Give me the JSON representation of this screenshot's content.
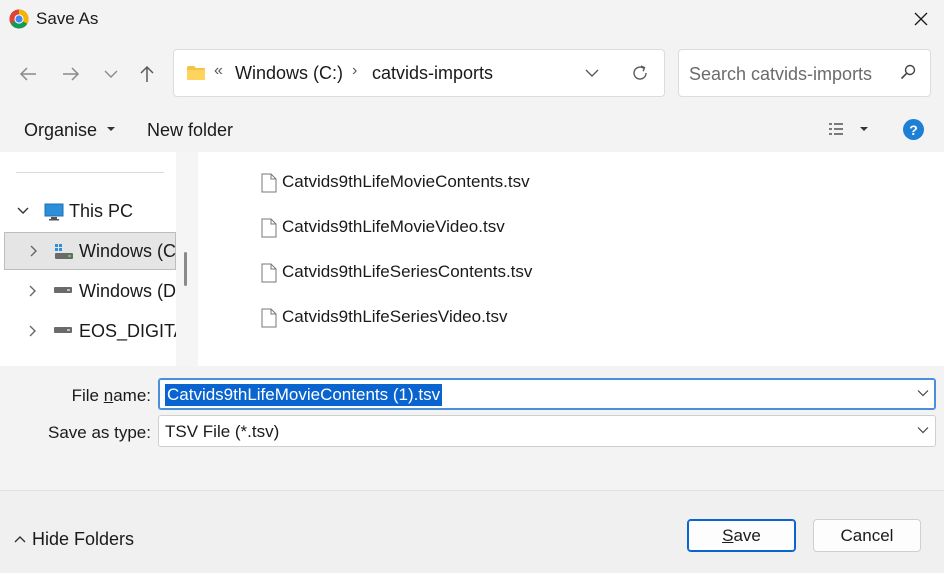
{
  "window": {
    "title": "Save As"
  },
  "address": {
    "overflow_glyph": "«",
    "segments": [
      "Windows (C:)",
      "catvids-imports"
    ],
    "separator": "›"
  },
  "search": {
    "placeholder": "Search catvids-imports"
  },
  "toolbar": {
    "organise_label": "Organise",
    "new_folder_label": "New folder",
    "help_label": "?"
  },
  "nav_tree": {
    "items": [
      {
        "label": "This PC",
        "expanded": true
      },
      {
        "label": "Windows (C",
        "selected": true
      },
      {
        "label": "Windows (D"
      },
      {
        "label": "EOS_DIGITA"
      }
    ]
  },
  "files": [
    "Catvids9thLifeMovieContents.tsv",
    "Catvids9thLifeMovieVideo.tsv",
    "Catvids9thLifeSeriesContents.tsv",
    "Catvids9thLifeSeriesVideo.tsv"
  ],
  "form": {
    "file_name_label_pre": "File ",
    "file_name_label_u": "n",
    "file_name_label_post": "ame:",
    "file_name_value": "Catvids9thLifeMovieContents (1).tsv",
    "save_type_label": "Save as type:",
    "save_type_value": "TSV File (*.tsv)"
  },
  "footer": {
    "hide_folders_label": "Hide Folders",
    "save_label_u": "S",
    "save_label_rest": "ave",
    "cancel_label": "Cancel"
  },
  "colors": {
    "accent": "#0a64d0",
    "help": "#1e7fd6",
    "folder": "#f5c342"
  }
}
